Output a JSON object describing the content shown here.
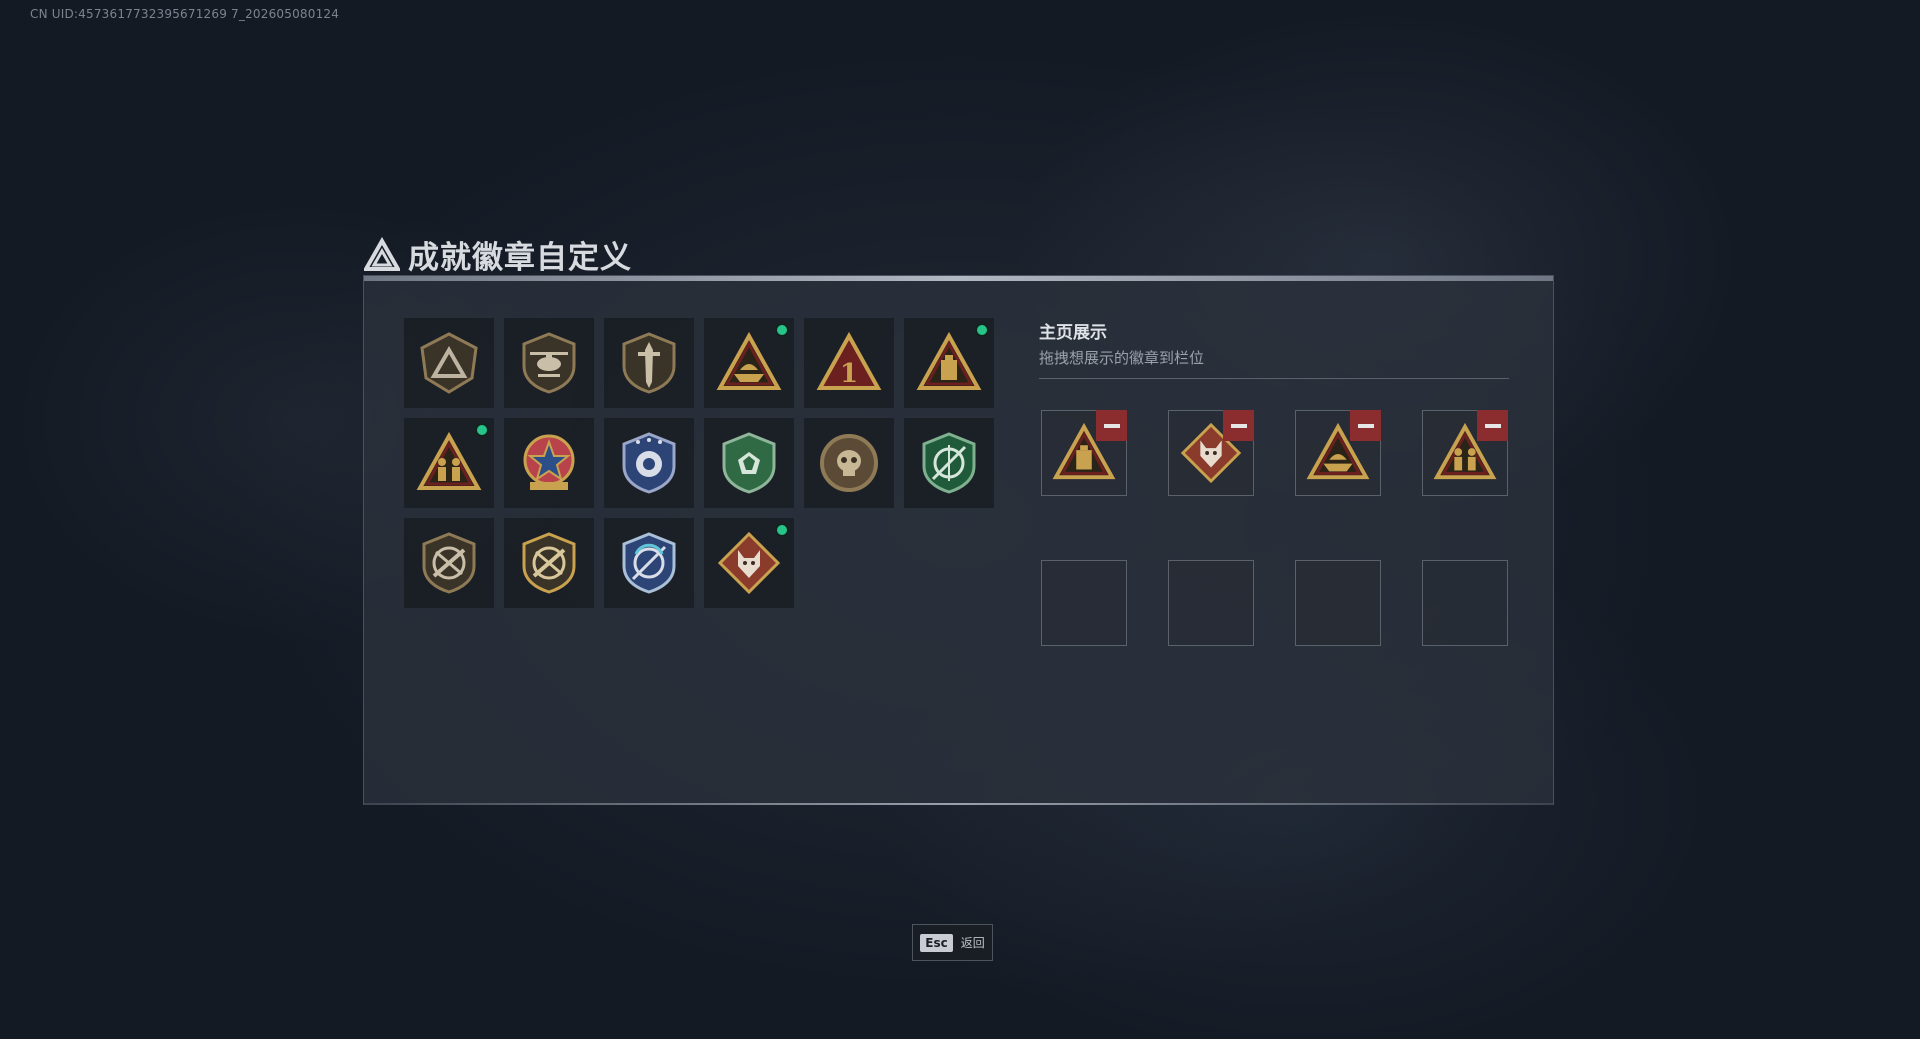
{
  "uid_text": "CN UID:4573617732395671269 7_202605080124",
  "title": "成就徽章自定义",
  "showcase": {
    "title": "主页展示",
    "subtitle": "拖拽想展示的徽章到栏位"
  },
  "badges": [
    {
      "icon": "bronze-triangle-shield-badge",
      "new": false
    },
    {
      "icon": "helicopter-shield-badge",
      "new": false
    },
    {
      "icon": "dagger-shield-badge",
      "new": false
    },
    {
      "icon": "gold-ship-triangle-badge",
      "new": true
    },
    {
      "icon": "red-number-one-triangle-badge",
      "new": false
    },
    {
      "icon": "gold-canister-triangle-badge",
      "new": true
    },
    {
      "icon": "gold-soldiers-triangle-badge",
      "new": true
    },
    {
      "icon": "star-medal-badge",
      "new": false
    },
    {
      "icon": "blue-eye-shield-badge",
      "new": false
    },
    {
      "icon": "green-gem-shield-badge",
      "new": false
    },
    {
      "icon": "bronze-skull-round-badge",
      "new": false
    },
    {
      "icon": "green-scope-shield-badge",
      "new": false
    },
    {
      "icon": "crossed-rifle-shield-badge",
      "new": false
    },
    {
      "icon": "crossed-rifle-gold-shield-badge",
      "new": false
    },
    {
      "icon": "blue-scope-shield-badge",
      "new": false
    },
    {
      "icon": "wolf-diamond-badge",
      "new": true
    }
  ],
  "showcase_slots": [
    {
      "icon": "gold-canister-triangle-badge",
      "filled": true
    },
    {
      "icon": "wolf-diamond-badge",
      "filled": true
    },
    {
      "icon": "gold-ship-triangle-badge",
      "filled": true
    },
    {
      "icon": "gold-soldiers-triangle-badge",
      "filled": true
    },
    {
      "icon": "",
      "filled": false
    },
    {
      "icon": "",
      "filled": false
    },
    {
      "icon": "",
      "filled": false
    },
    {
      "icon": "",
      "filled": false
    }
  ],
  "esc": {
    "key": "Esc",
    "label": "返回"
  },
  "colors": {
    "new_dot": "#27c48a",
    "remove_button": "#8b2c2e",
    "gold": "#c9a24f",
    "bronze": "#8f7a56"
  }
}
